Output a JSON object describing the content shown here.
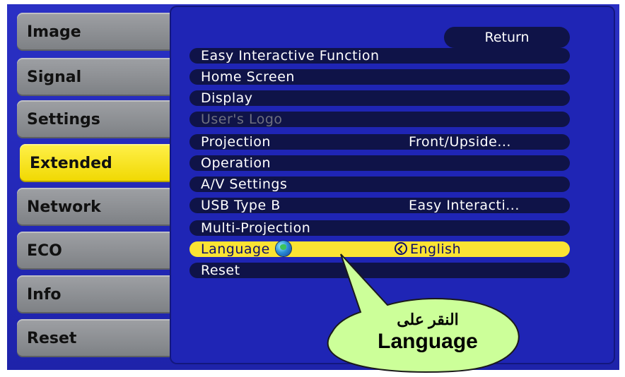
{
  "sidebar": {
    "tabs": [
      {
        "label": "Image"
      },
      {
        "label": "Signal"
      },
      {
        "label": "Settings"
      },
      {
        "label": "Extended"
      },
      {
        "label": "Network"
      },
      {
        "label": "ECO"
      },
      {
        "label": "Info"
      },
      {
        "label": "Reset"
      }
    ],
    "active": "Extended"
  },
  "menu": {
    "return_label": "Return",
    "items": [
      {
        "label": "Easy Interactive Function",
        "value": ""
      },
      {
        "label": "Home Screen",
        "value": ""
      },
      {
        "label": "Display",
        "value": ""
      },
      {
        "label": "User's Logo",
        "value": "",
        "disabled": true
      },
      {
        "label": "Projection",
        "value": "Front/Upside..."
      },
      {
        "label": "Operation",
        "value": ""
      },
      {
        "label": "A/V Settings",
        "value": ""
      },
      {
        "label": "USB Type B",
        "value": "Easy Interacti..."
      },
      {
        "label": "Multi-Projection",
        "value": ""
      },
      {
        "label": "Language",
        "value": "English",
        "selected": true
      },
      {
        "label": "Reset",
        "value": ""
      }
    ]
  },
  "callout": {
    "arabic": "النقر على",
    "english": "Language"
  },
  "colors": {
    "screen_blue": "#2328b8",
    "row_dark": "#0f1348",
    "highlight_yellow": "#fbe333",
    "tab_gray": "#8c8f93"
  },
  "icons": {
    "language_icon": "globe-icon",
    "value_icon": "enter-icon"
  }
}
